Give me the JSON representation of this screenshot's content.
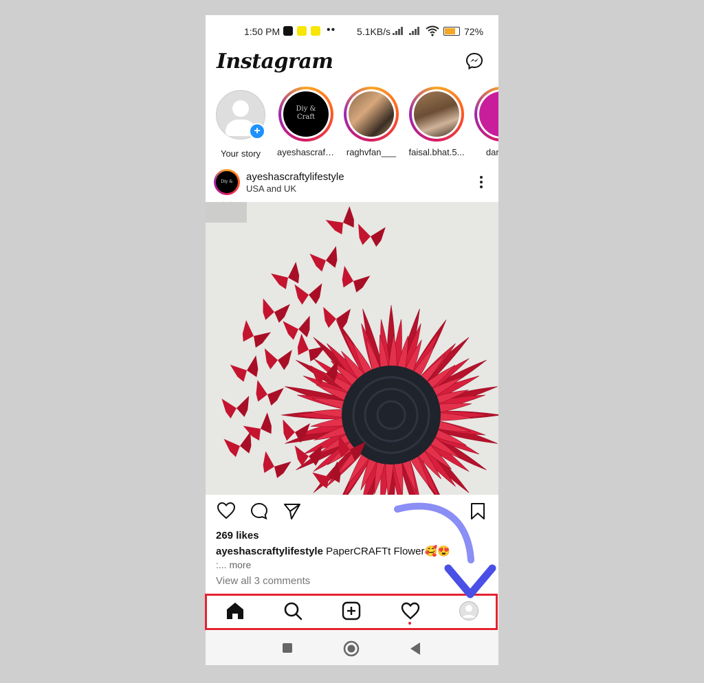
{
  "status_bar": {
    "time": "1:50 PM",
    "net_speed": "5.1KB/s",
    "battery": "72%"
  },
  "header": {
    "logo": "Instagram",
    "messenger_icon": "messenger-icon"
  },
  "stories": [
    {
      "name": "Your story",
      "type": "own"
    },
    {
      "name": "ayeshascraft...",
      "type": "story"
    },
    {
      "name": "raghvfan___",
      "type": "story"
    },
    {
      "name": "faisal.bhat.5...",
      "type": "story"
    },
    {
      "name": "dar.ya...",
      "type": "story"
    }
  ],
  "post": {
    "username": "ayeshascraftylifestyle",
    "location": "USA and UK",
    "avatar_text": "Diy & Craft",
    "likes": "269 likes",
    "caption_user": "ayeshascraftylifestyle",
    "caption_text": "PaperCRAFTt Flower🥰😍",
    "more": ":... more",
    "view_comments": "View all 3 comments"
  },
  "bottom_nav": {
    "items": [
      "home-icon",
      "search-icon",
      "new-post-icon",
      "activity-icon",
      "profile-icon"
    ]
  },
  "colors": {
    "highlight_box": "#e3232f",
    "arrow": "#7b7ff0",
    "story_ring": "#d81b60"
  }
}
